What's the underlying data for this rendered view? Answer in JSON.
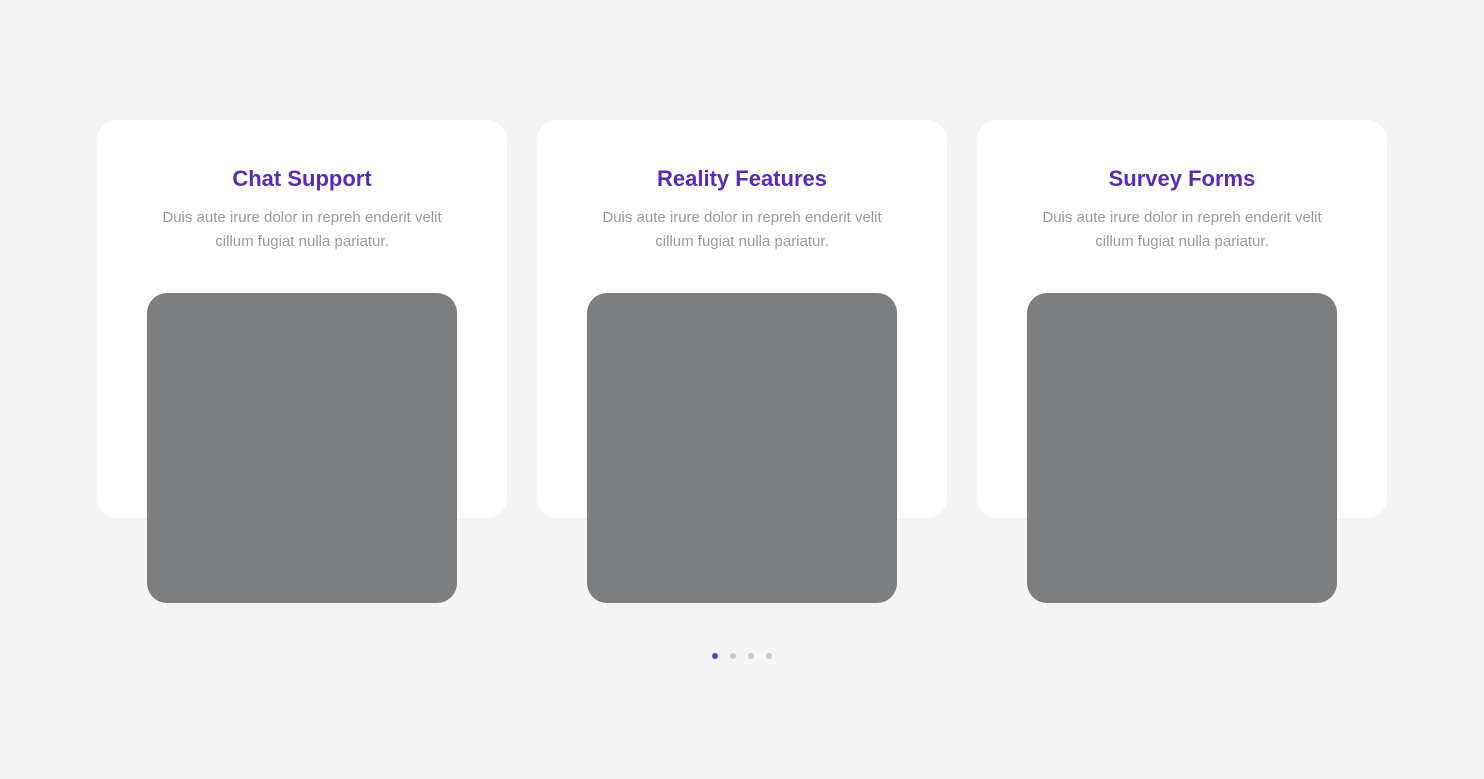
{
  "cards": [
    {
      "title": "Chat Support",
      "description_lines": [
        "Duis aute irure dolor in repreh enderit velit",
        "cillum fugiat nulla pariatur."
      ]
    },
    {
      "title": "Reality Features",
      "description_lines": [
        "Duis aute irure dolor in repreh enderit velit",
        "cillum fugiat nulla pariatur."
      ]
    },
    {
      "title": "Survey Forms",
      "description_lines": [
        "Duis aute irure dolor in repreh enderit velit",
        "cillum fugiat nulla pariatur."
      ]
    }
  ],
  "pagination": {
    "total": 4,
    "active_index": 0
  },
  "colors": {
    "background": "#f4f4f4",
    "card": "#ffffff",
    "title": "#5b2bb8",
    "description": "#9a9a9a",
    "image_placeholder": "#7d7e80",
    "dot_active": "#6a35c8",
    "dot_inactive": "#c9c9c9"
  }
}
